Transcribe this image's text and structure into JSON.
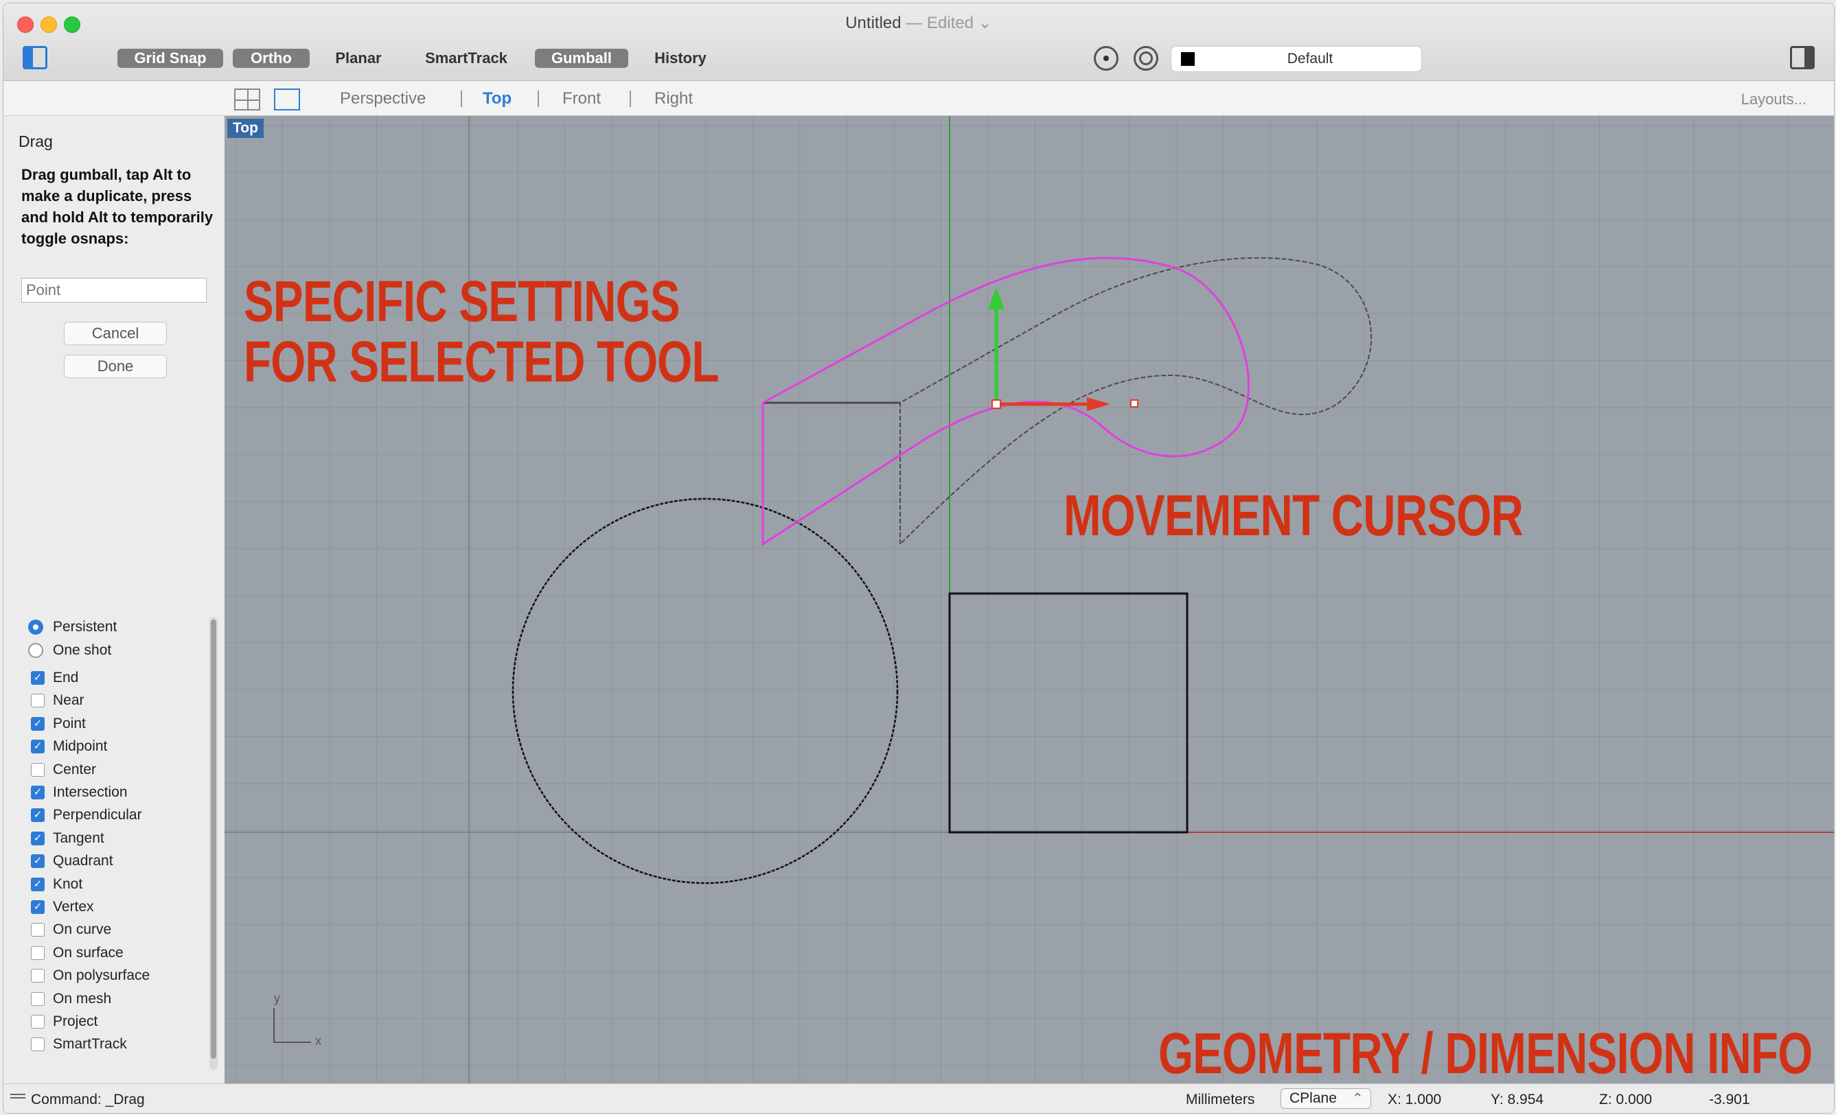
{
  "window": {
    "title": "Untitled",
    "title_suffix": "— Edited ⌄"
  },
  "toolbar": {
    "modes": [
      {
        "label": "Grid Snap",
        "active": true
      },
      {
        "label": "Ortho",
        "active": true
      },
      {
        "label": "Planar",
        "active": false
      },
      {
        "label": "SmartTrack",
        "active": false
      },
      {
        "label": "Gumball",
        "active": true
      },
      {
        "label": "History",
        "active": false
      }
    ],
    "layer": {
      "name": "Default",
      "color": "#000000"
    },
    "icons": [
      "sidebar-toggle-icon",
      "osnap-icon",
      "record-icon",
      "right-panel-icon"
    ]
  },
  "viewbar": {
    "tabs": [
      {
        "label": "Perspective",
        "active": false
      },
      {
        "label": "Top",
        "active": true
      },
      {
        "label": "Front",
        "active": false
      },
      {
        "label": "Right",
        "active": false
      }
    ],
    "layouts": "Layouts..."
  },
  "panel": {
    "heading": "Drag",
    "prompt": "Drag gumball, tap Alt to make a duplicate, press and hold Alt to temporarily toggle osnaps:",
    "input_placeholder": "Point",
    "cancel": "Cancel",
    "done": "Done"
  },
  "osnaps": {
    "radios": [
      {
        "label": "Persistent",
        "checked": true
      },
      {
        "label": "One shot",
        "checked": false
      }
    ],
    "checks": [
      {
        "label": "End",
        "checked": true
      },
      {
        "label": "Near",
        "checked": false
      },
      {
        "label": "Point",
        "checked": true
      },
      {
        "label": "Midpoint",
        "checked": true
      },
      {
        "label": "Center",
        "checked": false
      },
      {
        "label": "Intersection",
        "checked": true
      },
      {
        "label": "Perpendicular",
        "checked": true
      },
      {
        "label": "Tangent",
        "checked": true
      },
      {
        "label": "Quadrant",
        "checked": true
      },
      {
        "label": "Knot",
        "checked": true
      },
      {
        "label": "Vertex",
        "checked": true
      },
      {
        "label": "On curve",
        "checked": false
      },
      {
        "label": "On surface",
        "checked": false
      },
      {
        "label": "On polysurface",
        "checked": false
      },
      {
        "label": "On mesh",
        "checked": false
      },
      {
        "label": "Project",
        "checked": false
      },
      {
        "label": "SmartTrack",
        "checked": false
      }
    ]
  },
  "viewport": {
    "label": "Top",
    "axis_y": "y",
    "axis_x": "x",
    "colors": {
      "background": "#9ba1a9",
      "selected": "#e040e0",
      "x_axis": "#b04040",
      "y_axis": "#3a9a3a"
    }
  },
  "annotations": {
    "settings": [
      "SPECIFIC SETTINGS",
      "FOR SELECTED TOOL"
    ],
    "movement": "MOVEMENT CURSOR",
    "geometry": "GEOMETRY / DIMENSION INFO",
    "color": "#d13216"
  },
  "status": {
    "command": "Command: _Drag",
    "units": "Millimeters",
    "cplane": "CPlane",
    "x": "X: 1.000",
    "y": "Y: 8.954",
    "z": "Z: 0.000",
    "extra": "-3.901"
  }
}
